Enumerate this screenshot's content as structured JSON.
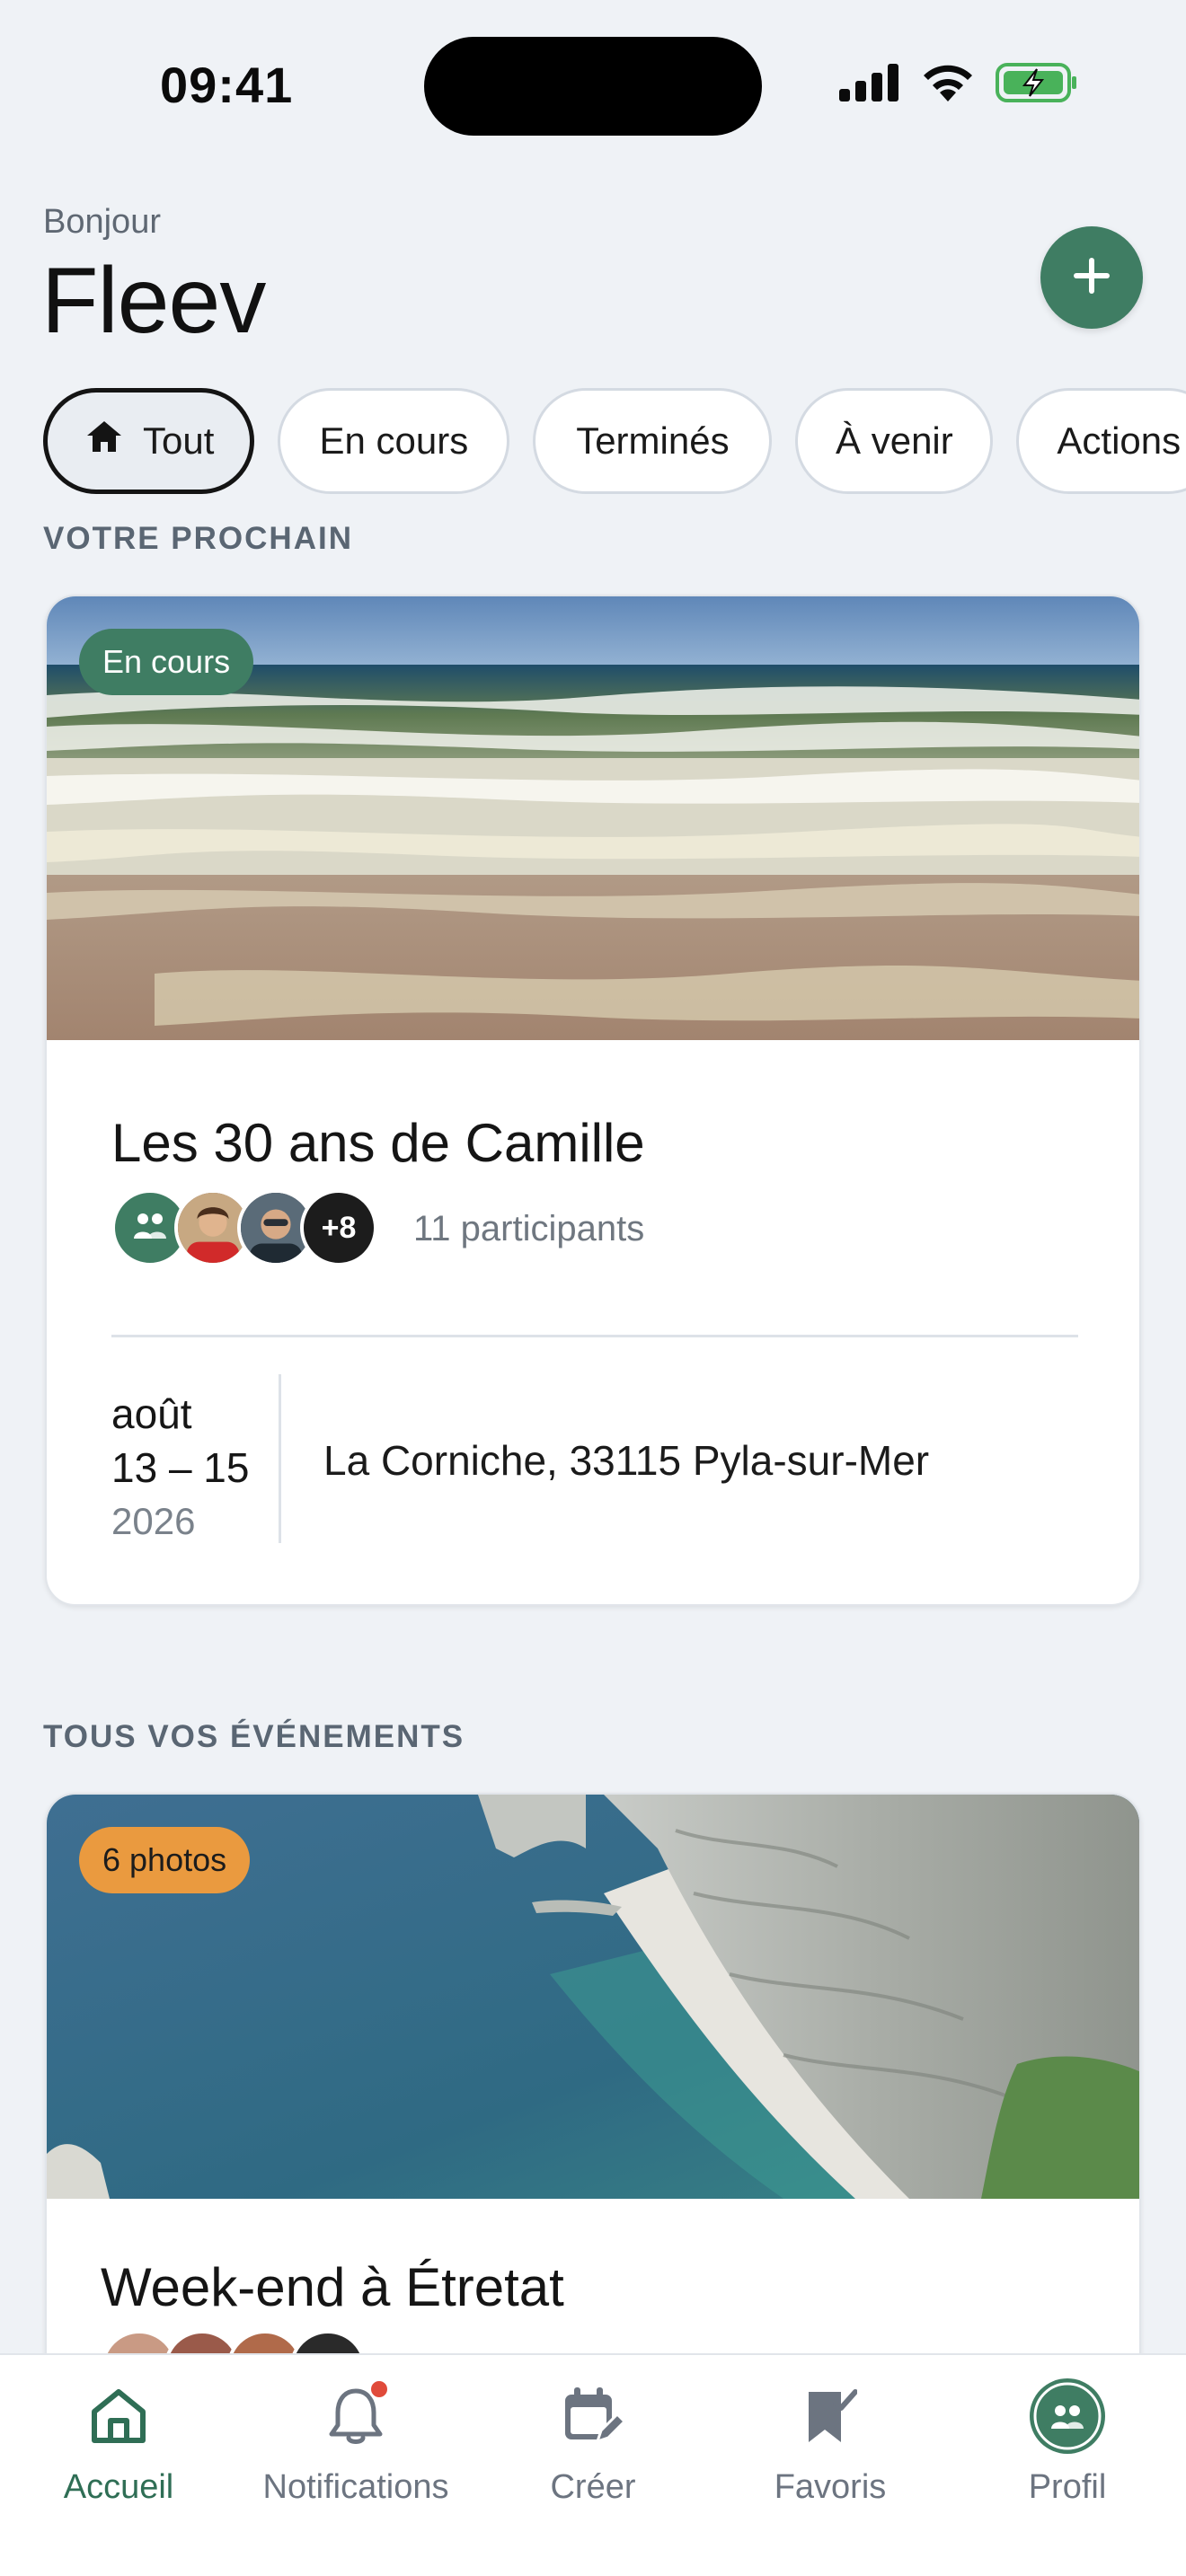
{
  "status_bar": {
    "time": "09:41"
  },
  "header": {
    "greeting": "Bonjour",
    "brand": "Fleev"
  },
  "filters": [
    "Tout",
    "En cours",
    "Terminés",
    "À venir",
    "Actions"
  ],
  "sections": {
    "next": "VOTRE PROCHAIN",
    "all": "TOUS VOS ÉVÉNEMENTS"
  },
  "next_event": {
    "badge": "En cours",
    "title": "Les 30 ans de Camille",
    "extra_participants": "+8",
    "participants": "11 participants",
    "date_month": "août",
    "date_range": "13 – 15",
    "date_year": "2026",
    "location": "La Corniche, 33115 Pyla-sur-Mer"
  },
  "event_card": {
    "badge": "6 photos",
    "title": "Week-end à Étretat"
  },
  "tabbar": {
    "items": [
      "Accueil",
      "Notifications",
      "Créer",
      "Favoris",
      "Profil"
    ]
  },
  "colors": {
    "accent_green": "#3f7d63",
    "badge_orange": "#ea9a3f",
    "notification_red": "#e04a3a"
  }
}
